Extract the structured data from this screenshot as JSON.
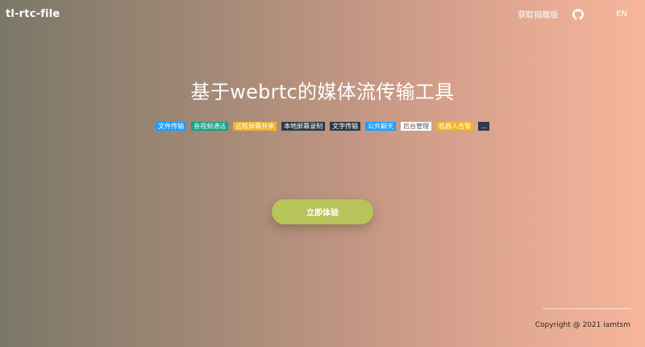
{
  "header": {
    "logo": "tl-rtc-file",
    "nav_link": "获取捐赠版",
    "lang": "EN",
    "github_icon": "github-icon"
  },
  "hero": {
    "title": "基于webrtc的媒体流传输工具"
  },
  "tags": [
    {
      "label": "文件传输",
      "color": "#1e9fff"
    },
    {
      "label": "音视频通话",
      "color": "#16a085"
    },
    {
      "label": "远程屏幕共享",
      "color": "#f0b429"
    },
    {
      "label": "本地屏幕录制",
      "color": "#2f3a48"
    },
    {
      "label": "文字传输",
      "color": "#2f3a48"
    },
    {
      "label": "公共聊天",
      "color": "#1e9fff"
    },
    {
      "label": "后台管理",
      "color": "#ffffff"
    },
    {
      "label": "机器人告警",
      "color": "#f0b429"
    },
    {
      "label": "...",
      "color": "#2f3a48"
    }
  ],
  "cta": {
    "label": "立即体验",
    "color": "#b6c45a"
  },
  "footer": {
    "copyright": "Copyright @ 2021 iamtsm"
  }
}
